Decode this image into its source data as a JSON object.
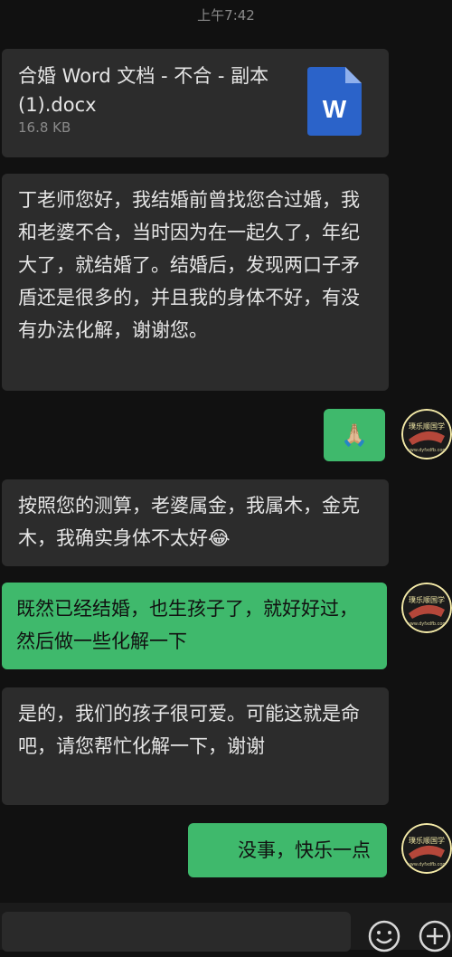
{
  "status": {
    "time": "上午7:42"
  },
  "file": {
    "name": "合婚 Word 文档 - 不合 - 副本(1).docx",
    "size": "16.8 KB",
    "icon_letter": "W"
  },
  "messages": [
    {
      "side": "incoming",
      "text": "丁老师您好，我结婚前曾找您合过婚，我和老婆不合，当时因为在一起久了，年纪大了，就结婚了。结婚后，发现两口子矛盾还是很多的，并且我的身体不好，有没有办法化解，谢谢您。"
    },
    {
      "side": "outgoing",
      "text": "🙏🏼"
    },
    {
      "side": "incoming",
      "text": "按照您的测算，老婆属金，我属木，金克木，我确实身体不太好😂"
    },
    {
      "side": "outgoing",
      "text": "既然已经结婚，也生孩子了，就好好过，然后做一些化解一下"
    },
    {
      "side": "incoming",
      "text": "是的，我们的孩子很可爱。可能这就是命吧，请您帮忙化解一下，谢谢"
    },
    {
      "side": "outgoing",
      "text": "没事，快乐一点"
    }
  ],
  "avatar": {
    "text_top": "璞乐顺国学",
    "text_bottom": "www.dyfxdfb.com"
  },
  "icons": {
    "emoji": "smile-icon",
    "more": "plus-icon"
  },
  "colors": {
    "background": "#111111",
    "incoming": "#2c2c2c",
    "outgoing": "#3fb96c",
    "word": "#2b63c9"
  }
}
